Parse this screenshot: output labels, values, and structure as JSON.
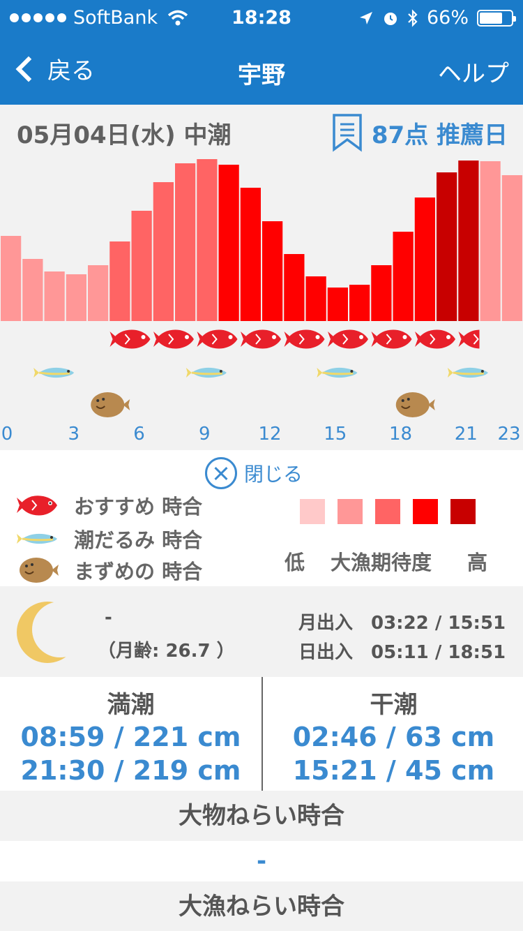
{
  "status_bar": {
    "carrier": "SoftBank",
    "time": "18:28",
    "battery": "66%"
  },
  "nav": {
    "back_label": "戻る",
    "title": "宇野",
    "help_label": "ヘルプ"
  },
  "day": {
    "date_label": "05月04日(水) 中潮",
    "score_label": "87点 推薦日"
  },
  "colors": {
    "header_blue": "#1a7bc9",
    "link_blue": "#3a8ad0",
    "level_1": "#ffc9c9",
    "level_2": "#ff9797",
    "level_3": "#ff6464",
    "level_4": "#ff0000",
    "level_5": "#c80000"
  },
  "chart_data": {
    "type": "bar",
    "x": [
      0,
      1,
      2,
      3,
      4,
      5,
      6,
      7,
      8,
      9,
      10,
      11,
      12,
      13,
      14,
      15,
      16,
      17,
      18,
      19,
      20,
      21,
      22,
      23
    ],
    "values": [
      122,
      89,
      71,
      67,
      80,
      114,
      158,
      199,
      226,
      232,
      224,
      191,
      143,
      96,
      64,
      48,
      52,
      80,
      128,
      177,
      213,
      230,
      229,
      209
    ],
    "level": [
      2,
      2,
      2,
      2,
      2,
      3,
      3,
      3,
      3,
      3,
      4,
      4,
      4,
      4,
      4,
      4,
      4,
      4,
      4,
      4,
      5,
      5,
      2,
      2
    ],
    "x_tick_labels": [
      "0",
      "3",
      "6",
      "9",
      "12",
      "15",
      "18",
      "21",
      "23"
    ],
    "oshi_hours": [
      5,
      6,
      7,
      8,
      9,
      10,
      11,
      12,
      13,
      14,
      15,
      16,
      17,
      18,
      19,
      20,
      21
    ],
    "shiodarumi_hours": [
      2,
      9,
      15,
      21
    ],
    "mazume_hours": [
      4.5,
      18.5
    ]
  },
  "legend": {
    "close_label": "閉じる",
    "items": [
      {
        "icon": "red-snapper-icon",
        "label": "おすすめ 時合"
      },
      {
        "icon": "blue-fish-icon",
        "label": "潮だるみ 時合"
      },
      {
        "icon": "flounder-icon",
        "label": "まずめの 時合"
      }
    ],
    "scale_low": "低",
    "scale_mid": "大漁期待度",
    "scale_high": "高"
  },
  "moon": {
    "phase": "-",
    "age": "（月齢: 26.7 ）",
    "moon_times": "月出入　03:22 / 15:51",
    "sun_times": "日出入　05:11 / 18:51"
  },
  "tides": {
    "high_label": "満潮",
    "high_1": "08:59 / 221 cm",
    "high_2": "21:30 / 219 cm",
    "low_label": "干潮",
    "low_1": "02:46 / 63 cm",
    "low_2": "15:21 / 45 cm"
  },
  "big_game": {
    "title": "大物ねらい時合",
    "value": "-"
  },
  "catch": {
    "title": "大漁ねらい時合"
  }
}
